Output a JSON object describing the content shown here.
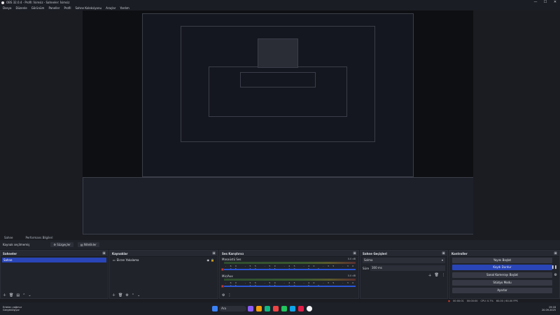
{
  "window": {
    "title": "OBS 32.0.4 - Profil: İsimsiz - Sahneler: İsimsiz",
    "minimize": "—",
    "maximize": "☐",
    "close": "✕"
  },
  "menu": [
    "Dosya",
    "Düzenle",
    "Görünüm",
    "Paneller",
    "Profil",
    "Sahne Koleksiyonu",
    "Araçlar",
    "Yardım"
  ],
  "tabs": {
    "scene_tab": "Sahne",
    "mixer_tab": "Performans Bilgileri"
  },
  "scene_bar": {
    "label": "Kaynak seçilmemiş",
    "filters_button": "Süzgeçler",
    "filters_icon": "gear-icon",
    "properties_button": "Nitelikler"
  },
  "docks": {
    "scenes": {
      "title": "Sahneler",
      "items": [
        "Sahne"
      ]
    },
    "sources": {
      "title": "Kaynaklar",
      "items": [
        {
          "label": "Ekran Yakalama",
          "icon": "monitor-icon"
        }
      ]
    },
    "mixer": {
      "title": "Ses Karıştırıcı",
      "channels": [
        {
          "name": "Masaüstü Ses",
          "db": "0.0 dB"
        },
        {
          "name": "Mic/Aux",
          "db": "0.0 dB"
        }
      ],
      "scale": [
        "-60",
        "-55",
        "-50",
        "-45",
        "-40",
        "-35",
        "-30",
        "-25",
        "-20",
        "-15",
        "-10",
        "-5",
        "0"
      ]
    },
    "transitions": {
      "title": "Sahne Geçişleri",
      "transition": "Solma",
      "duration_label": "Süre",
      "duration_value": "300 ms"
    },
    "controls": {
      "title": "Kontroller",
      "buttons": [
        "Yayını Başlat",
        "Kaydı Durdur",
        "Sanal Kamerayı Başlat",
        "Stüdyo Modu",
        "Ayarlar"
      ]
    }
  },
  "status": {
    "rec_time": "00:00:01",
    "stream_time": "00:00:00",
    "cpu": "CPU: 0.7%",
    "fps": "60.00 / 60.00 FPS"
  },
  "taskbar": {
    "weather": "Ertelen yağmur",
    "weather_sub": "Gerçekleşiyor",
    "search_placeholder": "Ara",
    "time": "19:18",
    "date": "20.09.2025"
  },
  "colors": {
    "accent": "#2945b8",
    "record": "#c0392b"
  }
}
